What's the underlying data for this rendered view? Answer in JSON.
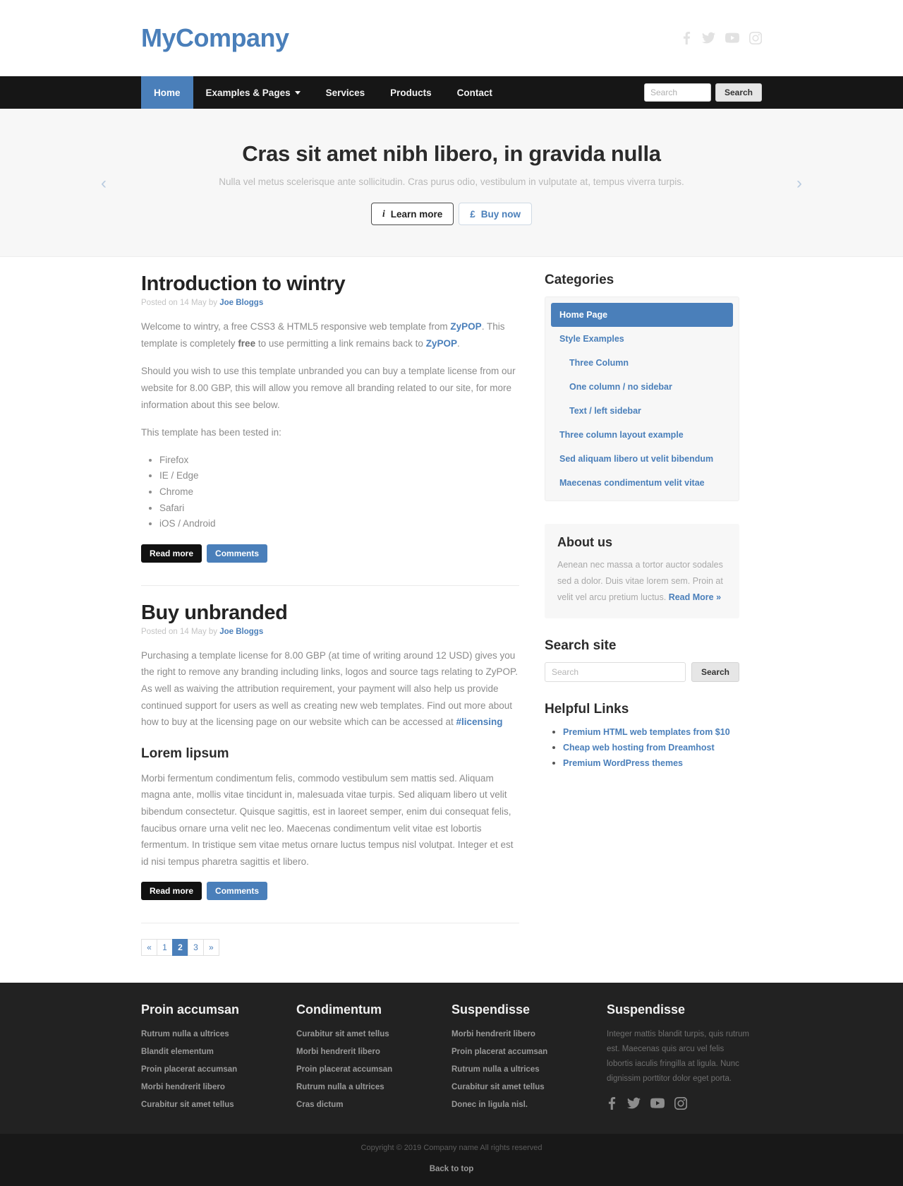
{
  "header": {
    "brand": "MyCompany",
    "social": [
      {
        "name": "facebook-icon",
        "label": "Facebook"
      },
      {
        "name": "twitter-icon",
        "label": "Twitter"
      },
      {
        "name": "youtube-icon",
        "label": "YouTube"
      },
      {
        "name": "instagram-icon",
        "label": "Instagram"
      }
    ]
  },
  "nav": {
    "items": [
      {
        "label": "Home",
        "active": true,
        "dropdown": false
      },
      {
        "label": "Examples & Pages",
        "active": false,
        "dropdown": true
      },
      {
        "label": "Services",
        "active": false,
        "dropdown": false
      },
      {
        "label": "Products",
        "active": false,
        "dropdown": false
      },
      {
        "label": "Contact",
        "active": false,
        "dropdown": false
      }
    ],
    "search_placeholder": "Search",
    "search_value": "",
    "search_button": "Search"
  },
  "hero": {
    "title": "Cras sit amet nibh libero, in gravida nulla",
    "subtitle": "Nulla vel metus scelerisque ante sollicitudin. Cras purus odio, vestibulum in vulputate at, tempus viverra turpis.",
    "btn_primary": "Learn more",
    "btn_primary_icon": "info-icon",
    "btn_secondary": "Buy now",
    "btn_secondary_icon": "pound-sterling-icon",
    "prev_arrow": "‹",
    "next_arrow": "›"
  },
  "articles": [
    {
      "title": "Introduction to wintry",
      "meta_prefix": "Posted on 14 May by ",
      "author": "Joe Bloggs",
      "paragraphs": [
        {
          "parts": [
            {
              "t": "Welcome to wintry, a free CSS3 & HTML5 responsive web template from ",
              "style": "plain"
            },
            {
              "t": "ZyPOP",
              "style": "link"
            },
            {
              "t": ". This template is completely ",
              "style": "plain"
            },
            {
              "t": "free",
              "style": "bold"
            },
            {
              "t": " to use permitting a link remains back to ",
              "style": "plain"
            },
            {
              "t": "ZyPOP",
              "style": "link"
            },
            {
              "t": ".",
              "style": "plain"
            }
          ]
        },
        {
          "parts": [
            {
              "t": "Should you wish to use this template unbranded you can buy a template license from our website for 8.00 GBP, this will allow you remove all branding related to our site, for more information about this see below.",
              "style": "plain"
            }
          ]
        },
        {
          "parts": [
            {
              "t": "This template has been tested in:",
              "style": "plain"
            }
          ]
        }
      ],
      "list": [
        "Firefox",
        "IE / Edge",
        "Chrome",
        "Safari",
        "iOS / Android"
      ],
      "btn_read": "Read more",
      "btn_comments": "Comments"
    },
    {
      "title": "Buy unbranded",
      "meta_prefix": "Posted on 14 May by ",
      "author": "Joe Bloggs",
      "paragraphs": [
        {
          "parts": [
            {
              "t": "Purchasing a template license for 8.00 GBP (at time of writing around 12 USD) gives you the right to remove any branding including links, logos and source tags relating to ZyPOP. As well as waiving the attribution requirement, your payment will also help us provide continued support for users as well as creating new web templates. Find out more about how to buy at the licensing page on our website which can be accessed at ",
              "style": "plain"
            },
            {
              "t": "#licensing",
              "style": "link"
            }
          ]
        }
      ],
      "subheading": "Lorem lipsum",
      "sub_paragraph": "Morbi fermentum condimentum felis, commodo vestibulum sem mattis sed. Aliquam magna ante, mollis vitae tincidunt in, malesuada vitae turpis. Sed aliquam libero ut velit bibendum consectetur. Quisque sagittis, est in laoreet semper, enim dui consequat felis, faucibus ornare urna velit nec leo. Maecenas condimentum velit vitae est lobortis fermentum. In tristique sem vitae metus ornare luctus tempus nisl volutpat. Integer et est id nisi tempus pharetra sagittis et libero.",
      "btn_read": "Read more",
      "btn_comments": "Comments"
    }
  ],
  "pagination": [
    {
      "label": "«",
      "active": false
    },
    {
      "label": "1",
      "active": false
    },
    {
      "label": "2",
      "active": true
    },
    {
      "label": "3",
      "active": false
    },
    {
      "label": "»",
      "active": false
    }
  ],
  "sidebar": {
    "categories_title": "Categories",
    "categories": [
      {
        "label": "Home Page",
        "active": true,
        "indent": false
      },
      {
        "label": "Style Examples",
        "active": false,
        "indent": false
      },
      {
        "label": "Three Column",
        "active": false,
        "indent": true
      },
      {
        "label": "One column / no sidebar",
        "active": false,
        "indent": true
      },
      {
        "label": "Text / left sidebar",
        "active": false,
        "indent": true
      },
      {
        "label": "Three column layout example",
        "active": false,
        "indent": false
      },
      {
        "label": "Sed aliquam libero ut velit bibendum",
        "active": false,
        "indent": false
      },
      {
        "label": "Maecenas condimentum velit vitae",
        "active": false,
        "indent": false
      }
    ],
    "about_title": "About us",
    "about_text": "Aenean nec massa a tortor auctor sodales sed a dolor. Duis vitae lorem sem. Proin at velit vel arcu pretium luctus. ",
    "about_link": "Read More »",
    "search_title": "Search site",
    "search_placeholder": "Search",
    "search_value": "",
    "search_button": "Search",
    "helpful_title": "Helpful Links",
    "helpful_links": [
      "Premium HTML web templates from $10",
      "Cheap web hosting from Dreamhost",
      "Premium WordPress themes"
    ]
  },
  "footer": {
    "columns": [
      {
        "title": "Proin accumsan",
        "links": [
          "Rutrum nulla a ultrices",
          "Blandit elementum",
          "Proin placerat accumsan",
          "Morbi hendrerit libero",
          "Curabitur sit amet tellus"
        ]
      },
      {
        "title": "Condimentum",
        "links": [
          "Curabitur sit amet tellus",
          "Morbi hendrerit libero",
          "Proin placerat accumsan",
          "Rutrum nulla a ultrices",
          "Cras dictum"
        ]
      },
      {
        "title": "Suspendisse",
        "links": [
          "Morbi hendrerit libero",
          "Proin placerat accumsan",
          "Rutrum nulla a ultrices",
          "Curabitur sit amet tellus",
          "Donec in ligula nisl."
        ]
      }
    ],
    "last_column": {
      "title": "Suspendisse",
      "text": "Integer mattis blandit turpis, quis rutrum est. Maecenas quis arcu vel felis lobortis iaculis fringilla at ligula. Nunc dignissim porttitor dolor eget porta.",
      "social": [
        {
          "name": "facebook-icon",
          "label": "Facebook"
        },
        {
          "name": "twitter-icon",
          "label": "Twitter"
        },
        {
          "name": "youtube-icon",
          "label": "YouTube"
        },
        {
          "name": "instagram-icon",
          "label": "Instagram"
        }
      ]
    },
    "copyright": "Copyright © 2019 Company name All rights reserved",
    "back_to_top": "Back to top"
  },
  "colors": {
    "accent_blue": "#4a7fba",
    "nav_black": "#161616",
    "footer_dark": "#222222",
    "subfooter_dark": "#181818",
    "hero_bg": "#f7f7f7"
  }
}
